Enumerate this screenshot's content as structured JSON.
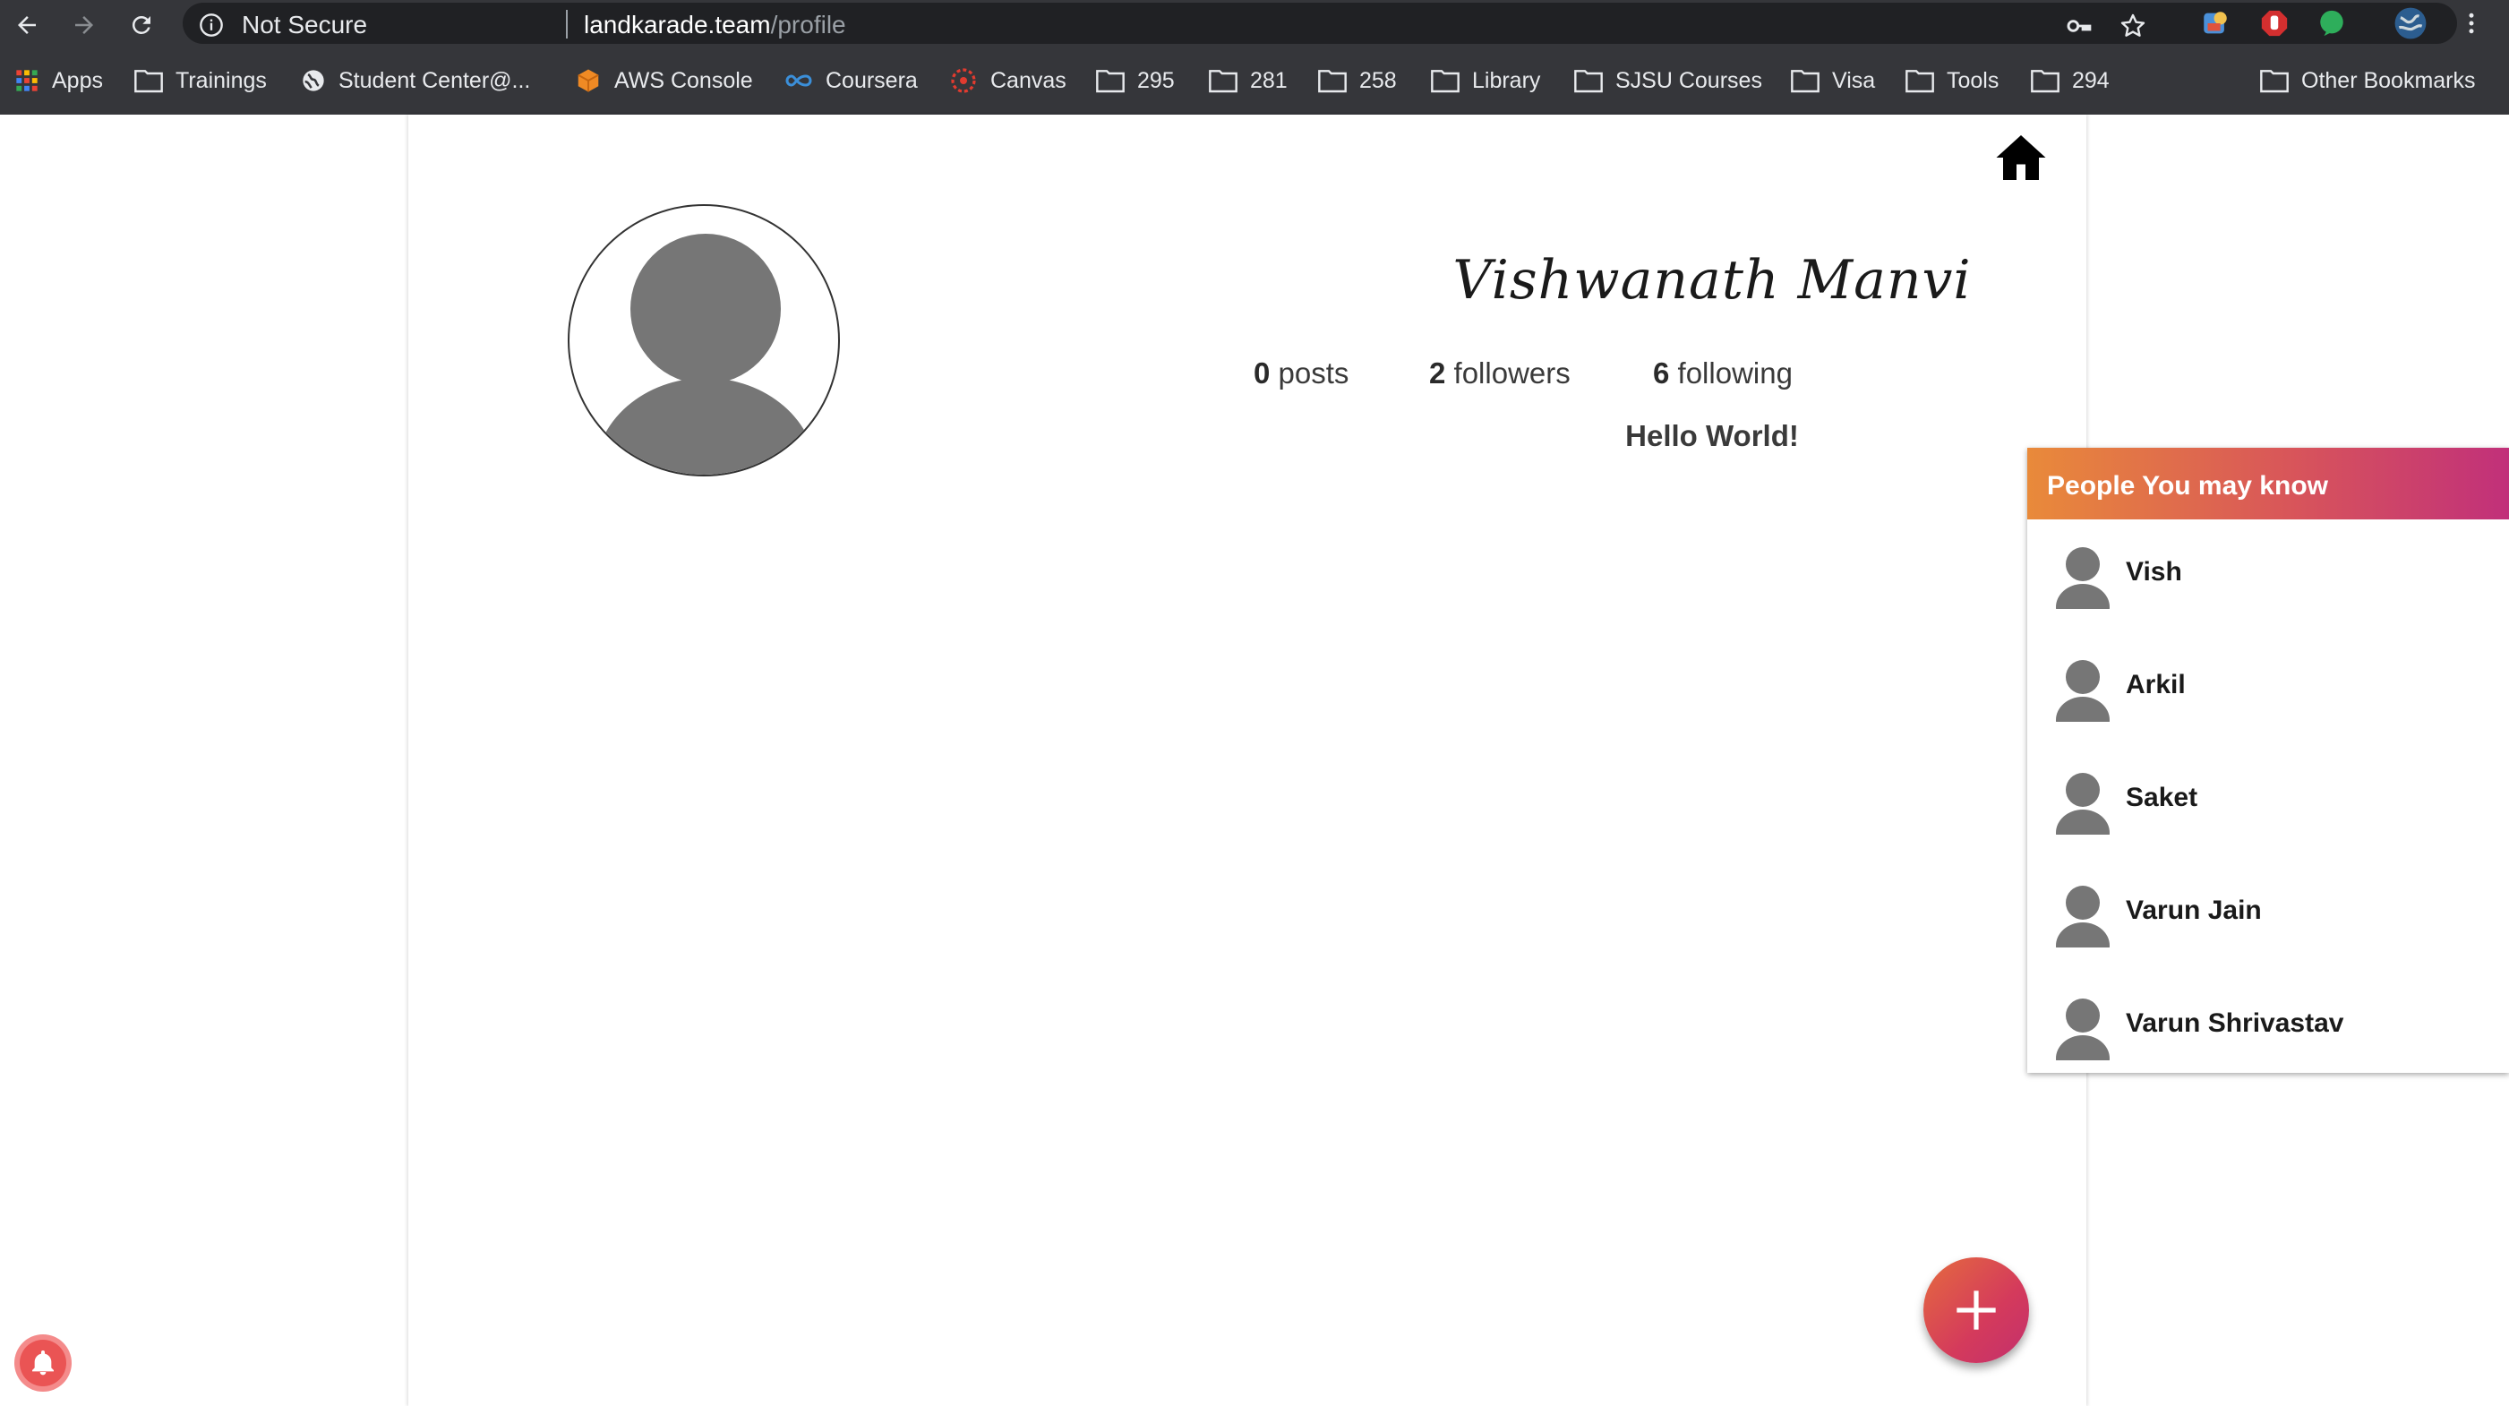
{
  "browser": {
    "security_label": "Not Secure",
    "url_host": "landkarade.team",
    "url_path": "/profile"
  },
  "bookmarks": {
    "apps": "Apps",
    "items": [
      "Trainings",
      "Student Center@...",
      "AWS Console",
      "Coursera",
      "Canvas",
      "295",
      "281",
      "258",
      "Library",
      "SJSU Courses",
      "Visa",
      "Tools",
      "294"
    ],
    "other": "Other Bookmarks"
  },
  "profile": {
    "name": "Vishwanath Manvi",
    "posts_count": "0",
    "posts_label": "posts",
    "followers_count": "2",
    "followers_label": "followers",
    "following_count": "6",
    "following_label": "following",
    "bio": "Hello World!"
  },
  "people_panel": {
    "title": "People You may know",
    "people": [
      "Vish",
      "Arkil",
      "Saket",
      "Varun Jain",
      "Varun Shrivastav"
    ]
  },
  "colors": {
    "chrome_bg": "#35363a",
    "omnibox_bg": "#202124",
    "accent_gradient_start": "#e98a3a",
    "accent_gradient_end": "#c1307a",
    "avatar_gray": "#767676"
  },
  "icons": {
    "back": "arrow-left-icon",
    "forward": "arrow-right-icon",
    "reload": "reload-icon",
    "info": "info-icon",
    "key": "key-icon",
    "star": "star-icon",
    "home": "home-icon",
    "add": "plus-icon",
    "notification": "bell-icon"
  }
}
